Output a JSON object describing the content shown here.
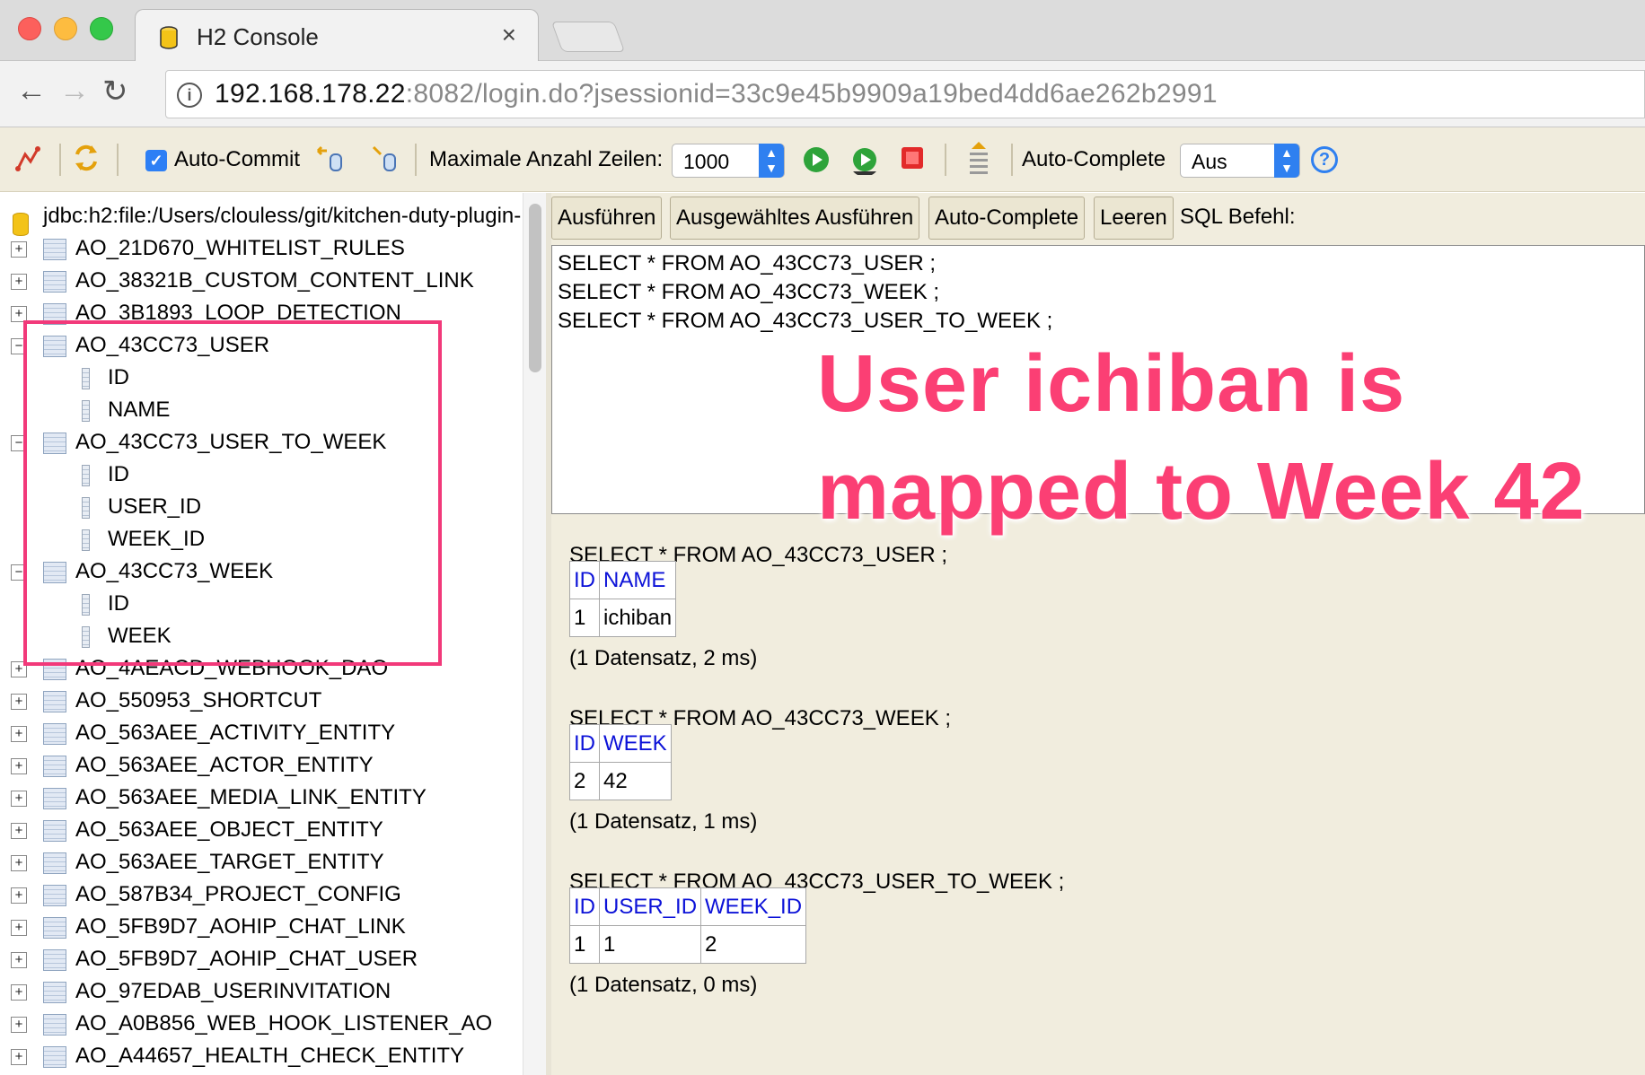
{
  "browser": {
    "tab_title": "H2 Console",
    "tab_close": "×",
    "url_host": "192.168.178.22",
    "url_rest": ":8082/login.do?jsessionid=33c9e45b9909a19bed4dd6ae262b2991"
  },
  "toolbar": {
    "auto_commit_label": "Auto-Commit",
    "max_rows_label": "Maximale Anzahl Zeilen:",
    "max_rows_value": "1000",
    "auto_complete_label": "Auto-Complete",
    "auto_complete_value": "Aus",
    "help": "?"
  },
  "tree": {
    "connection": "jdbc:h2:file:/Users/clouless/git/kitchen-duty-plugin-",
    "rows": [
      {
        "kind": "table",
        "exp": "+",
        "label": "AO_21D670_WHITELIST_RULES"
      },
      {
        "kind": "table",
        "exp": "+",
        "label": "AO_38321B_CUSTOM_CONTENT_LINK"
      },
      {
        "kind": "table",
        "exp": "+",
        "label": "AO_3B1893_LOOP_DETECTION"
      },
      {
        "kind": "table",
        "exp": "−",
        "label": "AO_43CC73_USER"
      },
      {
        "kind": "col",
        "label": "ID"
      },
      {
        "kind": "col",
        "label": "NAME"
      },
      {
        "kind": "table",
        "exp": "−",
        "label": "AO_43CC73_USER_TO_WEEK"
      },
      {
        "kind": "col",
        "label": "ID"
      },
      {
        "kind": "col",
        "label": "USER_ID"
      },
      {
        "kind": "col",
        "label": "WEEK_ID"
      },
      {
        "kind": "table",
        "exp": "−",
        "label": "AO_43CC73_WEEK"
      },
      {
        "kind": "col",
        "label": "ID"
      },
      {
        "kind": "col",
        "label": "WEEK"
      },
      {
        "kind": "table",
        "exp": "+",
        "label": "AO_4AEACD_WEBHOOK_DAO"
      },
      {
        "kind": "table",
        "exp": "+",
        "label": "AO_550953_SHORTCUT"
      },
      {
        "kind": "table",
        "exp": "+",
        "label": "AO_563AEE_ACTIVITY_ENTITY"
      },
      {
        "kind": "table",
        "exp": "+",
        "label": "AO_563AEE_ACTOR_ENTITY"
      },
      {
        "kind": "table",
        "exp": "+",
        "label": "AO_563AEE_MEDIA_LINK_ENTITY"
      },
      {
        "kind": "table",
        "exp": "+",
        "label": "AO_563AEE_OBJECT_ENTITY"
      },
      {
        "kind": "table",
        "exp": "+",
        "label": "AO_563AEE_TARGET_ENTITY"
      },
      {
        "kind": "table",
        "exp": "+",
        "label": "AO_587B34_PROJECT_CONFIG"
      },
      {
        "kind": "table",
        "exp": "+",
        "label": "AO_5FB9D7_AOHIP_CHAT_LINK"
      },
      {
        "kind": "table",
        "exp": "+",
        "label": "AO_5FB9D7_AOHIP_CHAT_USER"
      },
      {
        "kind": "table",
        "exp": "+",
        "label": "AO_97EDAB_USERINVITATION"
      },
      {
        "kind": "table",
        "exp": "+",
        "label": "AO_A0B856_WEB_HOOK_LISTENER_AO"
      },
      {
        "kind": "table",
        "exp": "+",
        "label": "AO_A44657_HEALTH_CHECK_ENTITY"
      }
    ]
  },
  "sql": {
    "buttons": [
      "Ausführen",
      "Ausgewähltes Ausführen",
      "Auto-Complete",
      "Leeren"
    ],
    "label": "SQL Befehl:",
    "editor_lines": [
      "SELECT * FROM AO_43CC73_USER ;",
      "SELECT * FROM AO_43CC73_WEEK ;",
      "SELECT * FROM AO_43CC73_USER_TO_WEEK ;"
    ]
  },
  "results": [
    {
      "query": "SELECT * FROM AO_43CC73_USER ;",
      "headers": [
        "ID",
        "NAME"
      ],
      "rows": [
        [
          "1",
          "ichiban"
        ]
      ],
      "note": "(1 Datensatz, 2 ms)"
    },
    {
      "query": "SELECT * FROM AO_43CC73_WEEK ;",
      "headers": [
        "ID",
        "WEEK"
      ],
      "rows": [
        [
          "2",
          "42"
        ]
      ],
      "note": "(1 Datensatz, 1 ms)"
    },
    {
      "query": "SELECT * FROM AO_43CC73_USER_TO_WEEK ;",
      "headers": [
        "ID",
        "USER_ID",
        "WEEK_ID"
      ],
      "rows": [
        [
          "1",
          "1",
          "2"
        ]
      ],
      "note": "(1 Datensatz, 0 ms)"
    }
  ],
  "annotation": {
    "line1": "User ichiban is",
    "line2": "mapped to Week 42",
    "color": "#fb3f74"
  }
}
